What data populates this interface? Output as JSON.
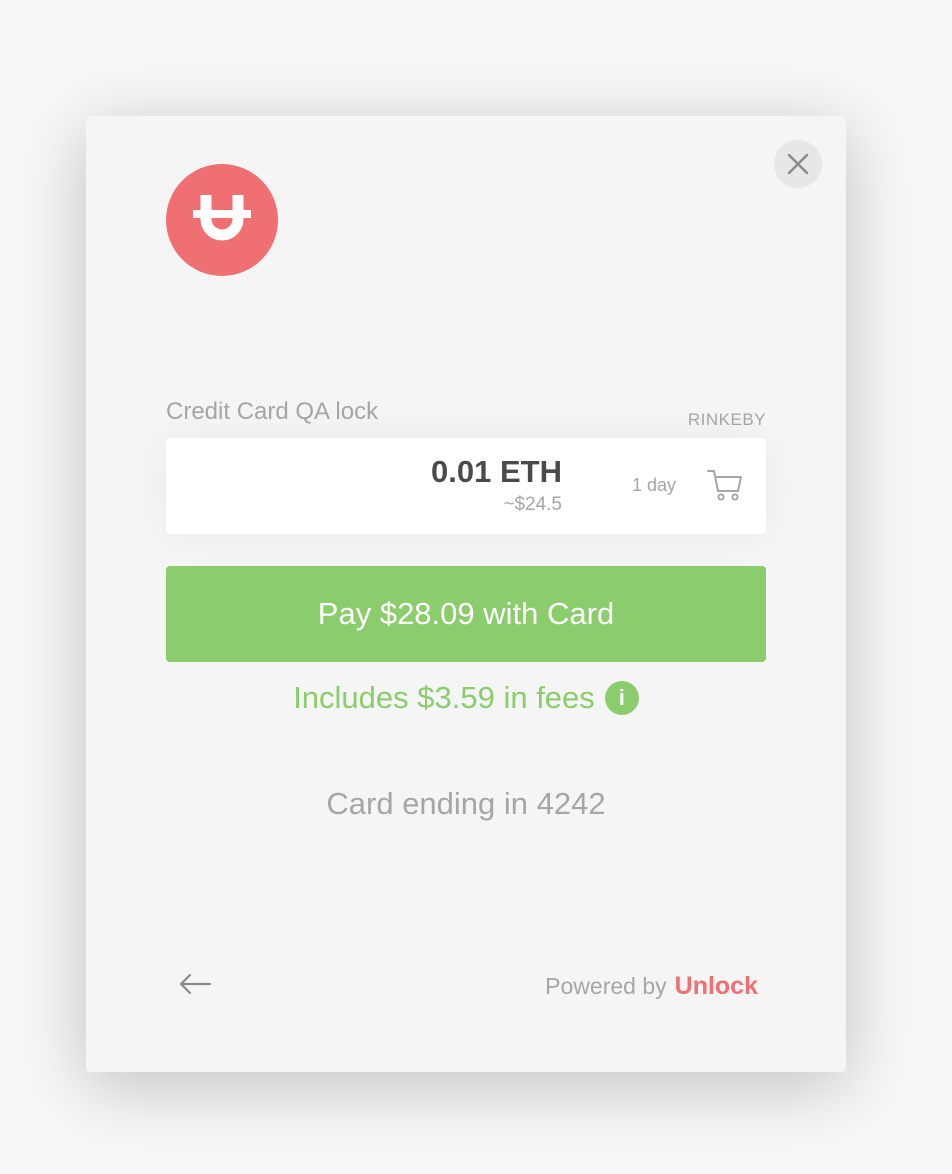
{
  "close": {
    "icon": "close-icon"
  },
  "logo": {
    "icon": "unlock-u-logo-icon"
  },
  "lock": {
    "name": "Credit Card QA lock",
    "network": "RINKEBY",
    "price_eth": "0.01 ETH",
    "price_usd": "~$24.5",
    "duration": "1 day",
    "cart_icon": "cart-icon"
  },
  "payment": {
    "button_label": "Pay $28.09 with Card",
    "fees_text": "Includes $3.59 in fees",
    "info_icon_glyph": "i",
    "card_text": "Card ending in 4242"
  },
  "footer": {
    "back_icon": "arrow-left-icon",
    "powered_by": "Powered by",
    "brand": "Unlock"
  },
  "colors": {
    "accent_green": "#8bcc6c",
    "brand_red": "#ef6f73",
    "muted_text": "#a6a6a6",
    "modal_bg": "#f5f5f5"
  }
}
